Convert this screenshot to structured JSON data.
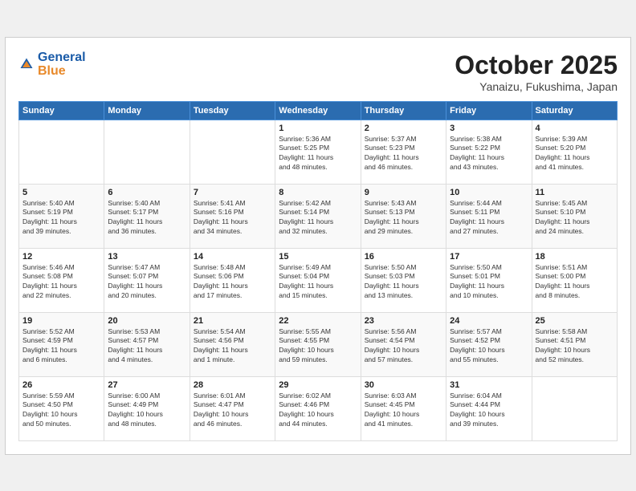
{
  "header": {
    "logo_line1": "General",
    "logo_line2": "Blue",
    "month": "October 2025",
    "location": "Yanaizu, Fukushima, Japan"
  },
  "days_of_week": [
    "Sunday",
    "Monday",
    "Tuesday",
    "Wednesday",
    "Thursday",
    "Friday",
    "Saturday"
  ],
  "weeks": [
    [
      {
        "day": "",
        "info": ""
      },
      {
        "day": "",
        "info": ""
      },
      {
        "day": "",
        "info": ""
      },
      {
        "day": "1",
        "info": "Sunrise: 5:36 AM\nSunset: 5:25 PM\nDaylight: 11 hours\nand 48 minutes."
      },
      {
        "day": "2",
        "info": "Sunrise: 5:37 AM\nSunset: 5:23 PM\nDaylight: 11 hours\nand 46 minutes."
      },
      {
        "day": "3",
        "info": "Sunrise: 5:38 AM\nSunset: 5:22 PM\nDaylight: 11 hours\nand 43 minutes."
      },
      {
        "day": "4",
        "info": "Sunrise: 5:39 AM\nSunset: 5:20 PM\nDaylight: 11 hours\nand 41 minutes."
      }
    ],
    [
      {
        "day": "5",
        "info": "Sunrise: 5:40 AM\nSunset: 5:19 PM\nDaylight: 11 hours\nand 39 minutes."
      },
      {
        "day": "6",
        "info": "Sunrise: 5:40 AM\nSunset: 5:17 PM\nDaylight: 11 hours\nand 36 minutes."
      },
      {
        "day": "7",
        "info": "Sunrise: 5:41 AM\nSunset: 5:16 PM\nDaylight: 11 hours\nand 34 minutes."
      },
      {
        "day": "8",
        "info": "Sunrise: 5:42 AM\nSunset: 5:14 PM\nDaylight: 11 hours\nand 32 minutes."
      },
      {
        "day": "9",
        "info": "Sunrise: 5:43 AM\nSunset: 5:13 PM\nDaylight: 11 hours\nand 29 minutes."
      },
      {
        "day": "10",
        "info": "Sunrise: 5:44 AM\nSunset: 5:11 PM\nDaylight: 11 hours\nand 27 minutes."
      },
      {
        "day": "11",
        "info": "Sunrise: 5:45 AM\nSunset: 5:10 PM\nDaylight: 11 hours\nand 24 minutes."
      }
    ],
    [
      {
        "day": "12",
        "info": "Sunrise: 5:46 AM\nSunset: 5:08 PM\nDaylight: 11 hours\nand 22 minutes."
      },
      {
        "day": "13",
        "info": "Sunrise: 5:47 AM\nSunset: 5:07 PM\nDaylight: 11 hours\nand 20 minutes."
      },
      {
        "day": "14",
        "info": "Sunrise: 5:48 AM\nSunset: 5:06 PM\nDaylight: 11 hours\nand 17 minutes."
      },
      {
        "day": "15",
        "info": "Sunrise: 5:49 AM\nSunset: 5:04 PM\nDaylight: 11 hours\nand 15 minutes."
      },
      {
        "day": "16",
        "info": "Sunrise: 5:50 AM\nSunset: 5:03 PM\nDaylight: 11 hours\nand 13 minutes."
      },
      {
        "day": "17",
        "info": "Sunrise: 5:50 AM\nSunset: 5:01 PM\nDaylight: 11 hours\nand 10 minutes."
      },
      {
        "day": "18",
        "info": "Sunrise: 5:51 AM\nSunset: 5:00 PM\nDaylight: 11 hours\nand 8 minutes."
      }
    ],
    [
      {
        "day": "19",
        "info": "Sunrise: 5:52 AM\nSunset: 4:59 PM\nDaylight: 11 hours\nand 6 minutes."
      },
      {
        "day": "20",
        "info": "Sunrise: 5:53 AM\nSunset: 4:57 PM\nDaylight: 11 hours\nand 4 minutes."
      },
      {
        "day": "21",
        "info": "Sunrise: 5:54 AM\nSunset: 4:56 PM\nDaylight: 11 hours\nand 1 minute."
      },
      {
        "day": "22",
        "info": "Sunrise: 5:55 AM\nSunset: 4:55 PM\nDaylight: 10 hours\nand 59 minutes."
      },
      {
        "day": "23",
        "info": "Sunrise: 5:56 AM\nSunset: 4:54 PM\nDaylight: 10 hours\nand 57 minutes."
      },
      {
        "day": "24",
        "info": "Sunrise: 5:57 AM\nSunset: 4:52 PM\nDaylight: 10 hours\nand 55 minutes."
      },
      {
        "day": "25",
        "info": "Sunrise: 5:58 AM\nSunset: 4:51 PM\nDaylight: 10 hours\nand 52 minutes."
      }
    ],
    [
      {
        "day": "26",
        "info": "Sunrise: 5:59 AM\nSunset: 4:50 PM\nDaylight: 10 hours\nand 50 minutes."
      },
      {
        "day": "27",
        "info": "Sunrise: 6:00 AM\nSunset: 4:49 PM\nDaylight: 10 hours\nand 48 minutes."
      },
      {
        "day": "28",
        "info": "Sunrise: 6:01 AM\nSunset: 4:47 PM\nDaylight: 10 hours\nand 46 minutes."
      },
      {
        "day": "29",
        "info": "Sunrise: 6:02 AM\nSunset: 4:46 PM\nDaylight: 10 hours\nand 44 minutes."
      },
      {
        "day": "30",
        "info": "Sunrise: 6:03 AM\nSunset: 4:45 PM\nDaylight: 10 hours\nand 41 minutes."
      },
      {
        "day": "31",
        "info": "Sunrise: 6:04 AM\nSunset: 4:44 PM\nDaylight: 10 hours\nand 39 minutes."
      },
      {
        "day": "",
        "info": ""
      }
    ]
  ]
}
